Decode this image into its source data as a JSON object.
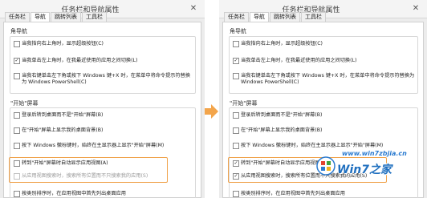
{
  "dialog": {
    "title": "任务栏和导航属性",
    "close_glyph": "✕",
    "tabs": [
      "任务栏",
      "导航",
      "跳转列表",
      "工具栏"
    ]
  },
  "left": {
    "section_corner": "角导航",
    "corner_options": [
      {
        "label": "当我指向右上角时，显示超级按钮(C)",
        "checked": false
      },
      {
        "label": "当我单击左上角时，在我最近使用的应用之间切换(L)",
        "checked": true
      },
      {
        "label": "当我右键单击左下角或按下 Windows 键+X 时，在菜单中将命令提示符替换为 Windows PowerShell(C)",
        "checked": false
      }
    ],
    "section_start": "\"开始\"屏幕",
    "start_options": [
      {
        "label": "登录后转到桌面而不是\"开始\"屏幕(B)",
        "checked": false
      },
      {
        "label": "在\"开始\"屏幕上显示我的桌面背景(B)",
        "checked": false
      },
      {
        "label": "按下 Windows 徽标键时，始终在主显示器上显示\"开始\"屏幕(M)",
        "checked": false
      },
      {
        "label": "转到\"开始\"屏幕时自动显示应用视图(A)",
        "checked": false
      },
      {
        "label": "从应用视图搜索时，搜索所有位置而不只搜索我的应用(S)",
        "checked": false,
        "disabled": true
      },
      {
        "label": "按类别排序时，在应用视图中首先列出桌面应用",
        "checked": false
      }
    ]
  },
  "right": {
    "section_corner": "角导航",
    "corner_options": [
      {
        "label": "当我指向右上角时，显示超级按钮(C)",
        "checked": false
      },
      {
        "label": "当我单击左上角时，在我最近使用的应用之间切换(L)",
        "checked": true
      },
      {
        "label": "当我右键单击左下角或按下 Windows 键+X 时，在菜单中将命令提示符替换为 Windows PowerShell(C)",
        "checked": false
      }
    ],
    "section_start": "\"开始\"屏幕",
    "start_options": [
      {
        "label": "登录后转到桌面而不是\"开始\"屏幕(B)",
        "checked": false
      },
      {
        "label": "在\"开始\"屏幕上显示我的桌面背景(B)",
        "checked": false
      },
      {
        "label": "按下 Windows 徽标键时，始终在主显示器上显示\"开始\"屏幕(M)",
        "checked": false
      },
      {
        "label": "转到\"开始\"屏幕时自动显示应用视图(A)",
        "checked": true
      },
      {
        "label": "从应用视图搜索时，搜索所有位置而不只搜索我的应用(S)",
        "checked": true
      },
      {
        "label": "按类别排序时，在应用视图中首先列出桌面应用",
        "checked": false
      }
    ]
  },
  "check_glyph": "✓",
  "watermark": {
    "url": "www.win7zbjia.cn",
    "text": "Win7之家"
  },
  "colors": {
    "highlight": "#f0a24a",
    "arrow": "#f3a54b",
    "watermark": "#1f6fbf"
  }
}
